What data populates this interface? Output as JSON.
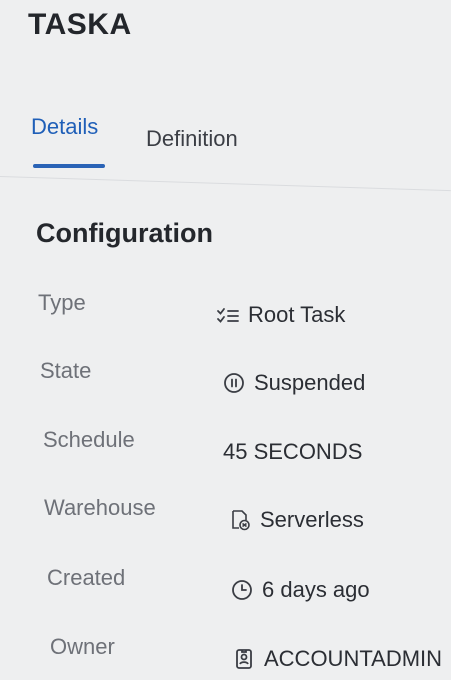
{
  "header": {
    "title": "TASKA"
  },
  "tabs": [
    {
      "label": "Details",
      "active": true
    },
    {
      "label": "Definition",
      "active": false
    }
  ],
  "configuration": {
    "title": "Configuration",
    "rows": [
      {
        "label": "Type",
        "value": "Root Task",
        "icon": "task-tree-icon"
      },
      {
        "label": "State",
        "value": "Suspended",
        "icon": "pause-circle-icon"
      },
      {
        "label": "Schedule",
        "value": "45 SECONDS",
        "icon": ""
      },
      {
        "label": "Warehouse",
        "value": "Serverless",
        "icon": "serverless-warehouse-icon"
      },
      {
        "label": "Created",
        "value": "6 days ago",
        "icon": "clock-icon"
      },
      {
        "label": "Owner",
        "value": "ACCOUNTADMIN",
        "icon": "user-badge-icon"
      }
    ]
  },
  "colors": {
    "accent": "#2a63b6",
    "background": "#eeeff0"
  }
}
